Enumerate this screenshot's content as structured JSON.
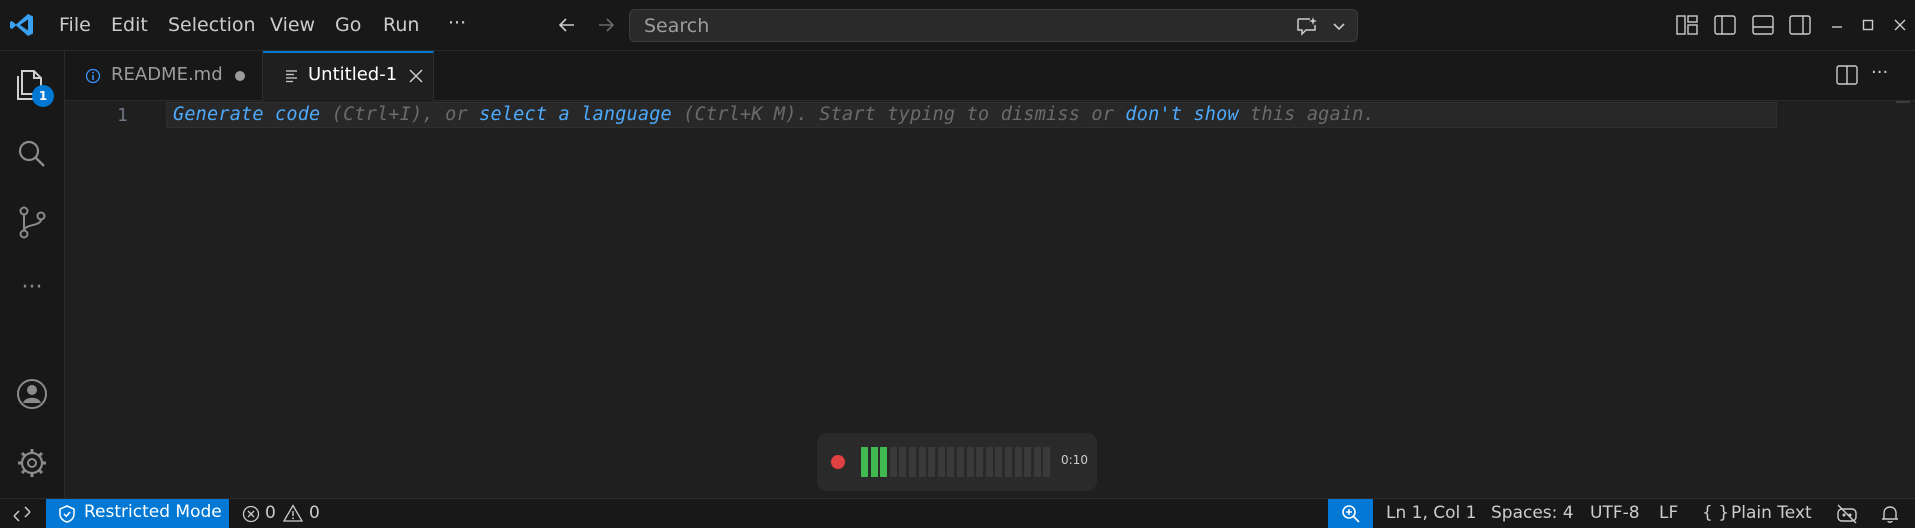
{
  "titlebar": {
    "menu": [
      "File",
      "Edit",
      "Selection",
      "View",
      "Go",
      "Run"
    ],
    "more_label": "···",
    "search_placeholder": "Search"
  },
  "activitybar": {
    "explorer_badge": "1",
    "more_label": "···"
  },
  "tabs": [
    {
      "label": "README.md",
      "modified": true,
      "icon": "info-icon"
    },
    {
      "label": "Untitled-1",
      "active": true,
      "icon": "text-file-icon"
    }
  ],
  "editor": {
    "line_number": "1",
    "hint": {
      "generate": "Generate code",
      "shortcut1": " (Ctrl+I), or ",
      "select": "select a language",
      "shortcut2": " (Ctrl+K M). Start typing to dismiss or ",
      "dont_show": "don't show",
      "tail": " this again."
    }
  },
  "recorder": {
    "time": "0:10",
    "level_bars_lit": 3,
    "level_bars_total": 20
  },
  "statusbar": {
    "restricted_mode": "Restricted Mode",
    "errors": "0",
    "warnings": "0",
    "position": "Ln 1, Col 1",
    "spaces": "Spaces: 4",
    "encoding": "UTF-8",
    "eol": "LF",
    "language": "Plain Text",
    "language_icon": "{ }"
  },
  "colors": {
    "accent": "#0078d4",
    "link": "#4daafc",
    "record": "#e04040",
    "level": "#3fb950"
  }
}
